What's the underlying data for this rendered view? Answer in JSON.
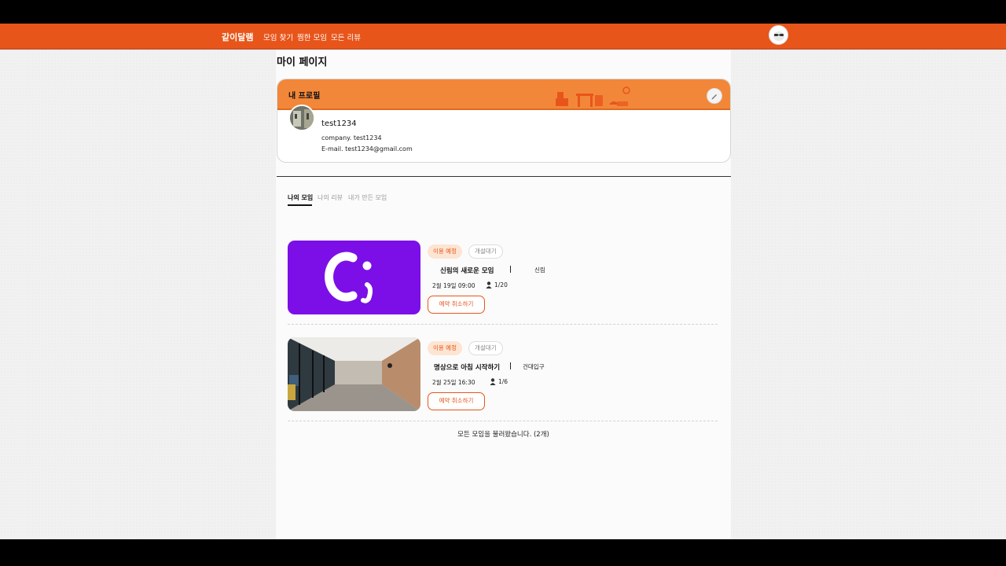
{
  "nav": {
    "brand": "같이달램",
    "items": [
      "모임 찾기",
      "찜한 모임",
      "모든 리뷰"
    ]
  },
  "page": {
    "title": "마이 페이지"
  },
  "profile": {
    "header": "내 프로필",
    "username": "test1234",
    "company_line": "company. test1234",
    "email_line": "E-mail. test1234@gmail.com"
  },
  "tabs": [
    "나의 모임",
    "나의 리뷰",
    "내가 만든 모임"
  ],
  "meetings": [
    {
      "badge_status": "이용 예정",
      "badge_open": "개설대기",
      "title": "신림의 새로운 모임",
      "location": "신림",
      "datetime": "2월 19일 09:00",
      "participants": "1/20",
      "action": "예약 취소하기"
    },
    {
      "badge_status": "이용 예정",
      "badge_open": "개설대기",
      "title": "명상으로 아침 시작하기",
      "location": "건대입구",
      "datetime": "2월 25일 16:30",
      "participants": "1/6",
      "action": "예약 취소하기"
    }
  ],
  "footer": {
    "message": "모든 모임을 불러왔습니다. (2개)"
  },
  "colors": {
    "brand": "#e8551a",
    "profile_header": "#f2873a",
    "thumb1_bg": "#7c0fe8"
  }
}
